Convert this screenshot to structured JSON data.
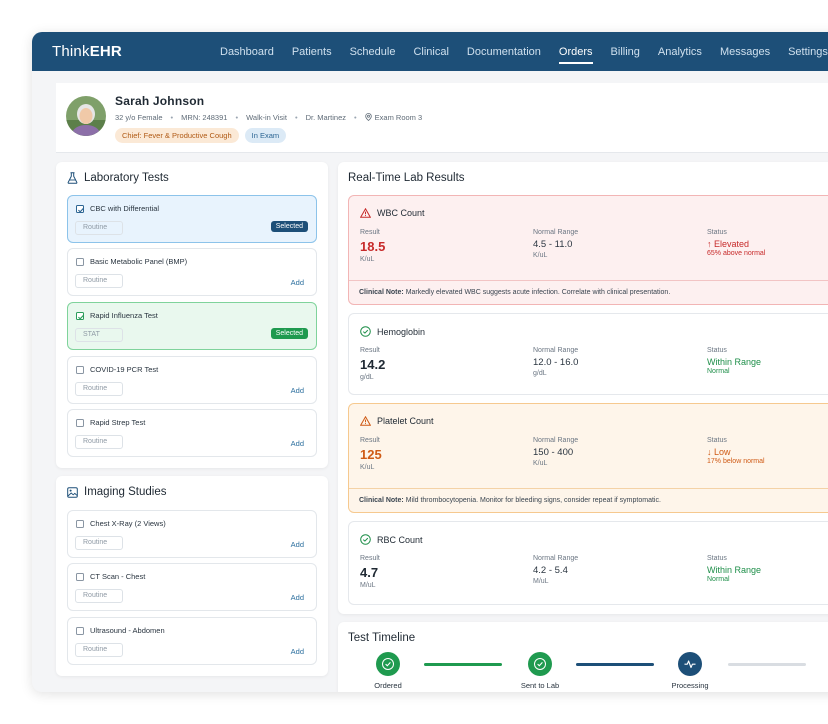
{
  "app": {
    "logo_light": "Think",
    "logo_bold": "EHR"
  },
  "nav": [
    {
      "label": "Dashboard"
    },
    {
      "label": "Patients"
    },
    {
      "label": "Schedule"
    },
    {
      "label": "Clinical"
    },
    {
      "label": "Documentation"
    },
    {
      "label": "Orders",
      "active": true
    },
    {
      "label": "Billing"
    },
    {
      "label": "Analytics"
    },
    {
      "label": "Messages"
    },
    {
      "label": "Settings"
    }
  ],
  "patient": {
    "name": "Sarah Johnson",
    "age_sex": "32 y/o Female",
    "mrn": "MRN: 248391",
    "visit": "Walk-in Visit",
    "doctor": "Dr. Martinez",
    "room": "Exam Room 3",
    "chief": "Chief: Fever & Productive Cough",
    "status": "In Exam"
  },
  "lab": {
    "title": "Laboratory Tests",
    "tests": [
      {
        "name": "CBC with Differential",
        "priority": "Routine",
        "selected": true,
        "style": "blue",
        "action": "Selected"
      },
      {
        "name": "Basic Metabolic Panel (BMP)",
        "priority": "Routine",
        "selected": false,
        "action": "Add"
      },
      {
        "name": "Rapid Influenza Test",
        "priority": "STAT",
        "selected": true,
        "style": "green",
        "action": "Selected"
      },
      {
        "name": "COVID-19 PCR Test",
        "priority": "Routine",
        "selected": false,
        "action": "Add"
      },
      {
        "name": "Rapid Strep Test",
        "priority": "Routine",
        "selected": false,
        "action": "Add"
      }
    ]
  },
  "imaging": {
    "title": "Imaging Studies",
    "tests": [
      {
        "name": "Chest X-Ray (2 Views)",
        "priority": "Routine",
        "action": "Add"
      },
      {
        "name": "CT Scan - Chest",
        "priority": "Routine",
        "action": "Add"
      },
      {
        "name": "Ultrasound - Abdomen",
        "priority": "Routine",
        "action": "Add"
      }
    ]
  },
  "results": {
    "title": "Real-Time Lab Results",
    "labels": {
      "result": "Result",
      "range": "Normal Range",
      "status": "Status",
      "note": "Clinical Note:"
    },
    "items": [
      {
        "name": "WBC Count",
        "value": "18.5",
        "unit": "K/uL",
        "range": "4.5 - 11.0",
        "range_unit": "K/uL",
        "status": "↑ Elevated",
        "status_sub": "65% above normal",
        "note": "Markedly elevated WBC suggests acute infection. Correlate with clinical presentation.",
        "level": "red"
      },
      {
        "name": "Hemoglobin",
        "value": "14.2",
        "unit": "g/dL",
        "range": "12.0 - 16.0",
        "range_unit": "g/dL",
        "status": "Within Range",
        "status_sub": "Normal",
        "level": "normal"
      },
      {
        "name": "Platelet Count",
        "value": "125",
        "unit": "K/uL",
        "range": "150 - 400",
        "range_unit": "K/uL",
        "status": "↓ Low",
        "status_sub": "17% below normal",
        "note": "Mild thrombocytopenia. Monitor for bleeding signs, consider repeat if symptomatic.",
        "level": "orange"
      },
      {
        "name": "RBC Count",
        "value": "4.7",
        "unit": "M/uL",
        "range": "4.2 - 5.4",
        "range_unit": "M/uL",
        "status": "Within Range",
        "status_sub": "Normal",
        "level": "normal"
      }
    ]
  },
  "timeline": {
    "title": "Test Timeline",
    "steps": [
      {
        "label": "Ordered",
        "state": "done"
      },
      {
        "label": "Sent to Lab",
        "state": "done"
      },
      {
        "label": "Processing",
        "state": "active"
      }
    ]
  },
  "colors": {
    "brand": "#1d4f78",
    "green": "#1f9a4f",
    "red": "#c72a2a",
    "orange": "#cf5a15"
  }
}
